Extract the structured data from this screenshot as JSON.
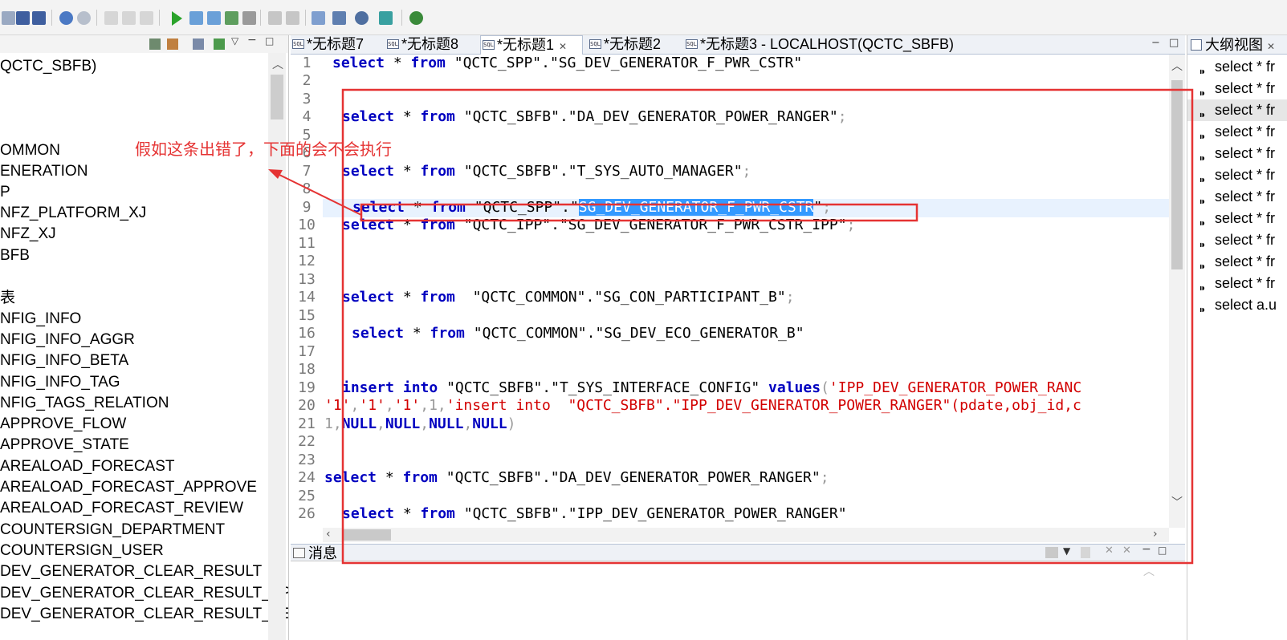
{
  "tree": {
    "items": [
      "QCTC_SBFB)",
      "OMMON",
      "ENERATION",
      "P",
      "NFZ_PLATFORM_XJ",
      "NFZ_XJ",
      "BFB",
      "表",
      "NFIG_INFO",
      "NFIG_INFO_AGGR",
      "NFIG_INFO_BETA",
      "NFIG_INFO_TAG",
      "NFIG_TAGS_RELATION",
      "APPROVE_FLOW",
      "APPROVE_STATE",
      "AREALOAD_FORECAST",
      "AREALOAD_FORECAST_APPROVE",
      "AREALOAD_FORECAST_REVIEW",
      "COUNTERSIGN_DEPARTMENT",
      "COUNTERSIGN_USER",
      "DEV_GENERATOR_CLEAR_RESULT",
      "DEV_GENERATOR_CLEAR_RESULT_APP",
      "DEV_GENERATOR_CLEAR_RESULT_REVI"
    ]
  },
  "tabs": [
    {
      "label": "*无标题7"
    },
    {
      "label": "*无标题8"
    },
    {
      "label": "*无标题1",
      "close": "✕"
    },
    {
      "label": "*无标题2"
    },
    {
      "label": "*无标题3 - LOCALHOST(QCTC_SBFB)"
    }
  ],
  "tab_icon_text": "SQL",
  "editor": {
    "line_numbers": [
      "1",
      "2",
      "3",
      "4",
      "5",
      "6",
      "7",
      "8",
      "9",
      "10",
      "11",
      "12",
      "13",
      "14",
      "15",
      "16",
      "17",
      "18",
      "19",
      "20",
      "21",
      "22",
      "23",
      "24",
      "25",
      "26"
    ],
    "lines": {
      "l1": {
        "kw1": "select",
        "op": " * ",
        "kw2": "from",
        "rest": " \"QCTC_SPP\".\"SG_DEV_GENERATOR_F_PWR_CSTR\""
      },
      "l4": {
        "kw1": "select",
        "op": " * ",
        "kw2": "from",
        "rest": " \"QCTC_SBFB\".\"DA_DEV_GENERATOR_POWER_RANGER\"",
        "semi": ";"
      },
      "l7": {
        "kw1": "select",
        "op": " * ",
        "kw2": "from",
        "rest": " \"QCTC_SBFB\".\"T_SYS_AUTO_MANAGER\"",
        "semi": ";"
      },
      "l9": {
        "kw1": "select",
        "op": " * ",
        "kw2": "from",
        "rest": " \"QCTC_SPP\".\"",
        "selected": "SG_DEV_GENERATOR_F_PWR_CSTR",
        "tail": "\"",
        "semi": ";"
      },
      "l10": {
        "kw1": "select",
        "op": " * ",
        "kw2": "from",
        "rest": " \"QCTC_IPP\".\"SG_DEV_GENERATOR_F_PWR_CSTR_IPP\"",
        "semi": ";"
      },
      "l14": {
        "kw1": "select",
        "op": " * ",
        "kw2": "from",
        "rest": "  \"QCTC_COMMON\".\"SG_CON_PARTICIPANT_B\"",
        "semi": ";"
      },
      "l16": {
        "kw1": "select",
        "op": " * ",
        "kw2": "from",
        "rest": " \"QCTC_COMMON\".\"SG_DEV_ECO_GENERATOR_B\""
      },
      "l19": {
        "kw1": "insert",
        "kw2": "into",
        "rest": " \"QCTC_SBFB\".\"T_SYS_INTERFACE_CONFIG\" ",
        "kw3": "values",
        "paren": "(",
        "str": "'IPP_DEV_GENERATOR_POWER_RANC"
      },
      "l20": {
        "a": "'1'",
        "b": ",",
        "c": "'1'",
        "d": ",",
        "e": "'1'",
        "f": ",1,",
        "g": "'insert into  \"QCTC_SBFB\".\"IPP_DEV_GENERATOR_POWER_RANGER\"(pdate,obj_id,c"
      },
      "l21": {
        "a": "1,",
        "n1": "NULL",
        "c1": ",",
        "n2": "NULL",
        "c2": ",",
        "n3": "NULL",
        "c3": ",",
        "n4": "NULL",
        "end": ")"
      },
      "l24": {
        "kw1": "select",
        "op": " * ",
        "kw2": "from",
        "rest": " \"QCTC_SBFB\".\"DA_DEV_GENERATOR_POWER_RANGER\"",
        "semi": ";"
      },
      "l26": {
        "kw1": "select",
        "op": " * ",
        "kw2": "from",
        "rest": " \"QCTC_SBFB\".\"IPP_DEV_GENERATOR_POWER_RANGER\""
      }
    }
  },
  "messages": {
    "label": "消息"
  },
  "outline": {
    "title": "大纲视图",
    "close": "✕",
    "items": [
      "select * fr",
      "select * fr",
      "select * fr",
      "select * fr",
      "select * fr",
      "select * fr",
      "select * fr",
      "select * fr",
      "select * fr",
      "select * fr",
      "select * fr",
      "select a.u"
    ],
    "selected_index": 2
  },
  "annotation": {
    "text": "假如这条出错了，下面的会不会执行",
    "color": "#e53333"
  },
  "colors": {
    "keyword": "#0000c0",
    "string": "#d20000",
    "selection": "#3399ff",
    "current_line": "#e8f2fe"
  }
}
